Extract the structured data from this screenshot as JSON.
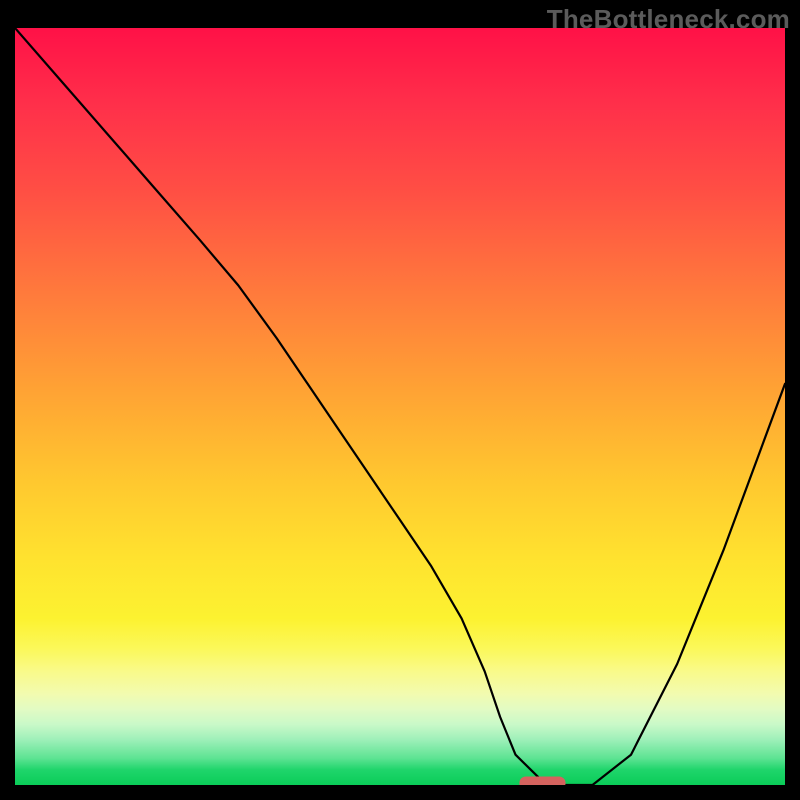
{
  "watermark": "TheBottleneck.com",
  "chart_data": {
    "type": "line",
    "title": "",
    "xlabel": "",
    "ylabel": "",
    "xlim": [
      0,
      100
    ],
    "ylim": [
      0,
      100
    ],
    "grid": false,
    "legend": false,
    "background": "rainbow_gradient_red_to_green_vertical",
    "series": [
      {
        "name": "bottleneck-curve",
        "color": "#000000",
        "x": [
          0,
          6,
          12,
          18,
          24,
          29,
          34,
          38,
          42,
          46,
          50,
          54,
          58,
          61,
          63,
          65,
          68,
          71,
          75,
          80,
          86,
          92,
          100
        ],
        "y": [
          100,
          93,
          86,
          79,
          72,
          66,
          59,
          53,
          47,
          41,
          35,
          29,
          22,
          15,
          9,
          4,
          1,
          0,
          0,
          4,
          16,
          31,
          53
        ]
      }
    ],
    "marker": {
      "name": "optimal-range",
      "shape": "pill",
      "color": "#d4635e",
      "x_start": 65.5,
      "x_end": 71.5,
      "y": 0
    }
  }
}
